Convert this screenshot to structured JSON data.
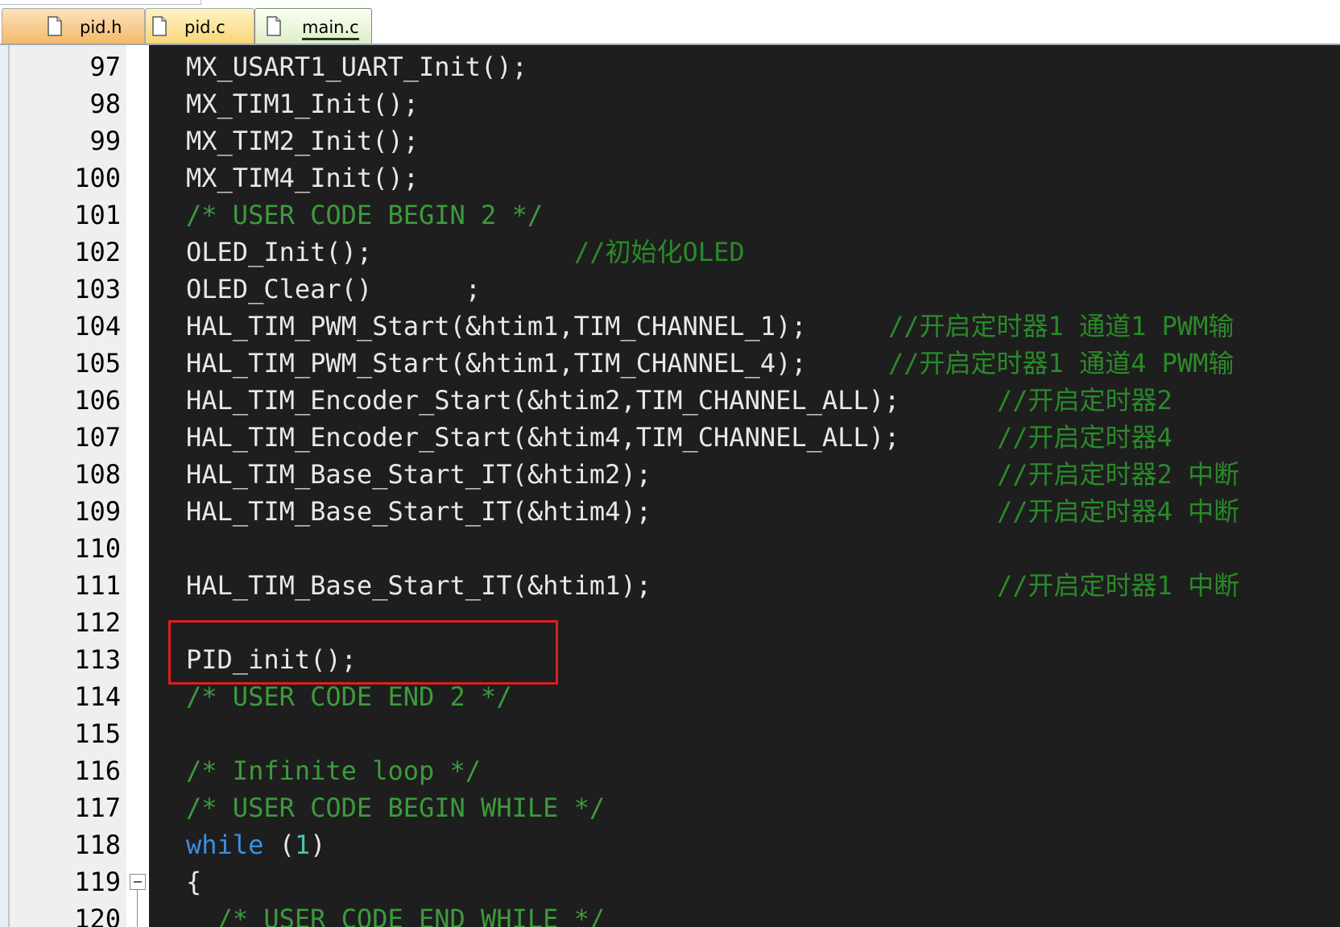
{
  "tabs": [
    {
      "label": "pid.h",
      "active": false
    },
    {
      "label": "pid.c",
      "active": false
    },
    {
      "label": "main.c",
      "active": true
    }
  ],
  "colors": {
    "editor_bg": "#1e1e1e",
    "comment": "#3d9a3d",
    "keyword": "#3a8fe0",
    "number": "#44c4b4",
    "highlight_box": "#e01e1e"
  },
  "lines": [
    {
      "num": "97",
      "code": "MX_USART1_UART_Init();",
      "comment": ""
    },
    {
      "num": "98",
      "code": "MX_TIM1_Init();",
      "comment": ""
    },
    {
      "num": "99",
      "code": "MX_TIM2_Init();",
      "comment": ""
    },
    {
      "num": "100",
      "code": "MX_TIM4_Init();",
      "comment": ""
    },
    {
      "num": "101",
      "code": "/* USER CODE BEGIN 2 */",
      "comment": ""
    },
    {
      "num": "102",
      "code": "OLED_Init();",
      "comment": "//初始化OLED"
    },
    {
      "num": "103",
      "code": "OLED_Clear()      ;",
      "comment": ""
    },
    {
      "num": "104",
      "code": "HAL_TIM_PWM_Start(&htim1,TIM_CHANNEL_1);",
      "comment": "//开启定时器1 通道1 PWM输"
    },
    {
      "num": "105",
      "code": "HAL_TIM_PWM_Start(&htim1,TIM_CHANNEL_4);",
      "comment": "//开启定时器1 通道4 PWM输"
    },
    {
      "num": "106",
      "code": "HAL_TIM_Encoder_Start(&htim2,TIM_CHANNEL_ALL);",
      "comment": "//开启定时器2"
    },
    {
      "num": "107",
      "code": "HAL_TIM_Encoder_Start(&htim4,TIM_CHANNEL_ALL);",
      "comment": "//开启定时器4"
    },
    {
      "num": "108",
      "code": "HAL_TIM_Base_Start_IT(&htim2);",
      "comment": "//开启定时器2 中断"
    },
    {
      "num": "109",
      "code": "HAL_TIM_Base_Start_IT(&htim4);",
      "comment": "//开启定时器4 中断"
    },
    {
      "num": "110",
      "code": "",
      "comment": ""
    },
    {
      "num": "111",
      "code": "HAL_TIM_Base_Start_IT(&htim1);",
      "comment": "//开启定时器1 中断"
    },
    {
      "num": "112",
      "code": "",
      "comment": ""
    },
    {
      "num": "113",
      "code": "PID_init();",
      "comment": ""
    },
    {
      "num": "114",
      "code": "/* USER CODE END 2 */",
      "comment": ""
    },
    {
      "num": "115",
      "code": "",
      "comment": ""
    },
    {
      "num": "116",
      "code": "/* Infinite loop */",
      "comment": ""
    },
    {
      "num": "117",
      "code": "/* USER CODE BEGIN WHILE */",
      "comment": ""
    },
    {
      "num": "118",
      "code_keyword": "while",
      "code_open": " (",
      "code_number": "1",
      "code_close": ")",
      "comment": ""
    },
    {
      "num": "119",
      "code": "{",
      "comment": ""
    },
    {
      "num": "120",
      "code": "  /* USER CODE END WHILE */",
      "comment": ""
    }
  ]
}
